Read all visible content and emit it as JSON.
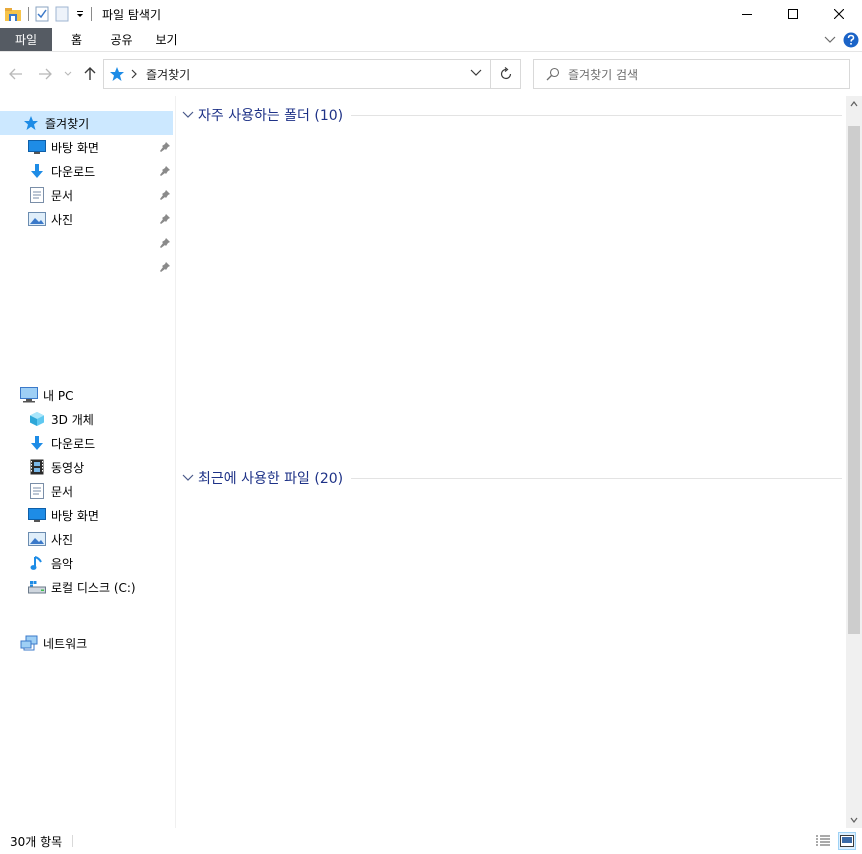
{
  "window": {
    "title": "파일 탐색기"
  },
  "ribbon": {
    "tabs": [
      {
        "label": "파일"
      },
      {
        "label": "홈"
      },
      {
        "label": "공유"
      },
      {
        "label": "보기"
      }
    ]
  },
  "address": {
    "path_label": "즐겨찾기"
  },
  "search": {
    "placeholder": "즐겨찾기 검색"
  },
  "nav": {
    "quick_access": {
      "label": "즐겨찾기",
      "items": [
        {
          "label": "바탕 화면",
          "icon": "desktop-icon",
          "pinned": true
        },
        {
          "label": "다운로드",
          "icon": "download-arrow-icon",
          "pinned": true
        },
        {
          "label": "문서",
          "icon": "document-icon",
          "pinned": true
        },
        {
          "label": "사진",
          "icon": "picture-icon",
          "pinned": true
        }
      ]
    },
    "this_pc": {
      "label": "내 PC",
      "items": [
        {
          "label": "3D 개체",
          "icon": "cube-icon"
        },
        {
          "label": "다운로드",
          "icon": "download-arrow-icon"
        },
        {
          "label": "동영상",
          "icon": "video-film-icon"
        },
        {
          "label": "문서",
          "icon": "document-icon"
        },
        {
          "label": "바탕 화면",
          "icon": "desktop-icon"
        },
        {
          "label": "사진",
          "icon": "picture-icon"
        },
        {
          "label": "음악",
          "icon": "music-note-icon"
        },
        {
          "label": "로컬 디스크 (C:)",
          "icon": "drive-icon"
        }
      ]
    },
    "network": {
      "label": "네트워크"
    }
  },
  "content": {
    "groups": [
      {
        "title": "자주 사용하는 폴더 (10)"
      },
      {
        "title": "최근에 사용한 파일 (20)"
      }
    ]
  },
  "status": {
    "item_count": "30개 항목"
  },
  "colors": {
    "accent": "#1e3287",
    "selection": "#cce8ff",
    "file_tab": "#555b63",
    "icon_blue": "#1e8ce6"
  }
}
